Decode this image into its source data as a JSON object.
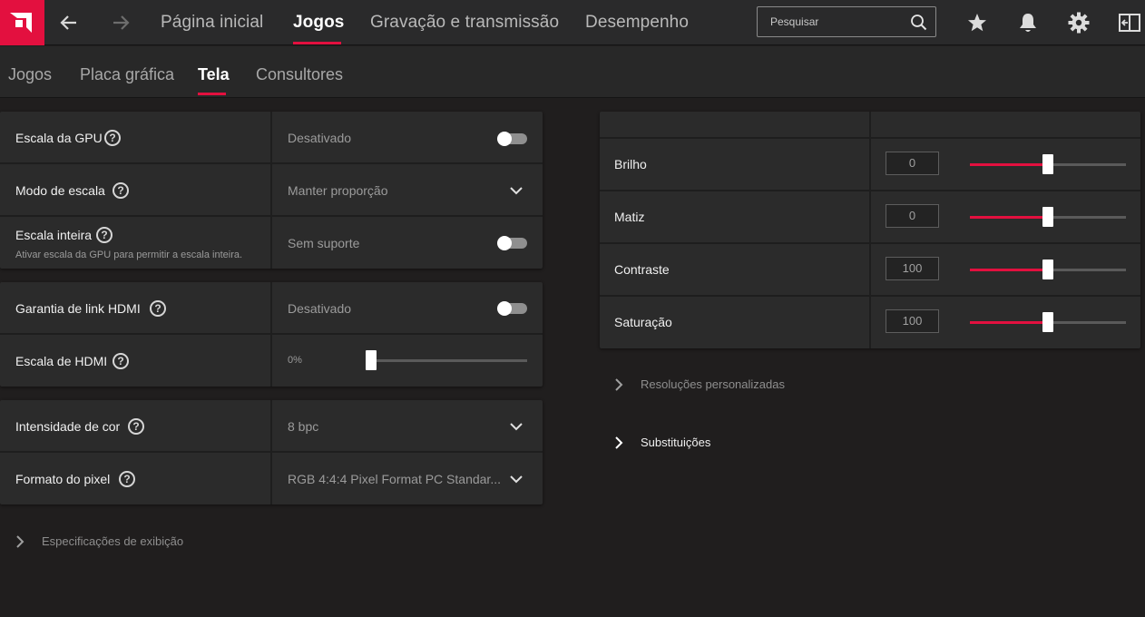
{
  "colors": {
    "accent": "#e3103f",
    "background": "#201e1e",
    "card": "#2b2b2b",
    "topbar": "#2a2a2b"
  },
  "topnav": {
    "logo_icon": "amd-logo-icon",
    "back_icon": "arrow-left-icon",
    "forward_icon": "arrow-right-icon",
    "links": [
      "Página inicial",
      "Jogos",
      "Gravação e transmissão",
      "Desempenho"
    ],
    "active": "Jogos",
    "search_placeholder": "Pesquisar",
    "icons": [
      "star-icon",
      "bell-icon",
      "gear-icon",
      "sidebar-icon"
    ]
  },
  "subtabs": {
    "items": [
      "Jogos",
      "Placa gráfica",
      "Tela",
      "Consultores"
    ],
    "active": "Tela"
  },
  "left": {
    "group1": [
      {
        "label": "Escala da GPU",
        "value": "Desativado",
        "control": "toggle",
        "on": false
      },
      {
        "label": "Modo de escala",
        "value": "Manter proporção",
        "control": "dropdown"
      },
      {
        "label": "Escala inteira",
        "sublabel": "Ativar escala da GPU para permitir a escala inteira.",
        "value": "Sem suporte",
        "control": "toggle",
        "on": false
      }
    ],
    "group2": [
      {
        "label": "Garantia de link HDMI",
        "value": "Desativado",
        "control": "toggle",
        "on": false
      },
      {
        "label": "Escala de HDMI",
        "value": "0%",
        "control": "slider",
        "level": 0
      }
    ],
    "group3": [
      {
        "label": "Intensidade de cor",
        "value": "8 bpc",
        "control": "dropdown"
      },
      {
        "label": "Formato do pixel",
        "value": "RGB 4:4:4 Pixel Format PC Standar...",
        "control": "dropdown"
      }
    ],
    "expander": "Especificações de exibição"
  },
  "right": {
    "sliders": [
      {
        "label": "Brilho",
        "value": "0",
        "level": 0.5
      },
      {
        "label": "Matiz",
        "value": "0",
        "level": 0.5
      },
      {
        "label": "Contraste",
        "value": "100",
        "level": 0.5
      },
      {
        "label": "Saturação",
        "value": "100",
        "level": 0.5
      }
    ],
    "expanders": [
      "Resoluções personalizadas",
      "Substituições"
    ]
  }
}
